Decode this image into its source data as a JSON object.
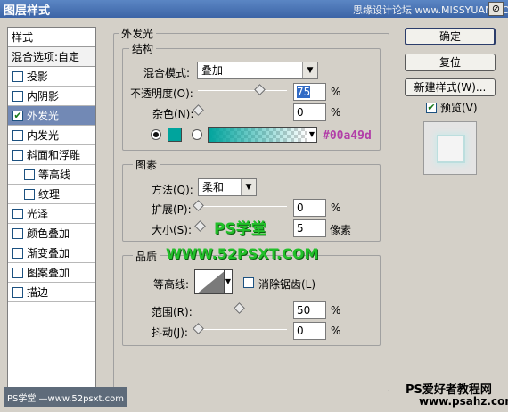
{
  "window": {
    "title": "图层样式",
    "close_label": "⊘",
    "watermark_top": "思缘设计论坛 www.MISSYUAN.COM"
  },
  "style_list": {
    "header": "样式",
    "blend_options": "混合选项:自定",
    "items": [
      {
        "label": "投影",
        "checked": false,
        "sub": false,
        "selected": false
      },
      {
        "label": "内阴影",
        "checked": false,
        "sub": false,
        "selected": false
      },
      {
        "label": "外发光",
        "checked": true,
        "sub": false,
        "selected": true
      },
      {
        "label": "内发光",
        "checked": false,
        "sub": false,
        "selected": false
      },
      {
        "label": "斜面和浮雕",
        "checked": false,
        "sub": false,
        "selected": false
      },
      {
        "label": "等高线",
        "checked": false,
        "sub": true,
        "selected": false
      },
      {
        "label": "纹理",
        "checked": false,
        "sub": true,
        "selected": false
      },
      {
        "label": "光泽",
        "checked": false,
        "sub": false,
        "selected": false
      },
      {
        "label": "颜色叠加",
        "checked": false,
        "sub": false,
        "selected": false
      },
      {
        "label": "渐变叠加",
        "checked": false,
        "sub": false,
        "selected": false
      },
      {
        "label": "图案叠加",
        "checked": false,
        "sub": false,
        "selected": false
      },
      {
        "label": "描边",
        "checked": false,
        "sub": false,
        "selected": false
      }
    ]
  },
  "buttons": {
    "ok": "确定",
    "reset": "复位",
    "new_style": "新建样式(W)...",
    "preview": "预览(V)",
    "preview_checked": true
  },
  "outer_glow": {
    "title": "外发光",
    "structure": {
      "title": "结构",
      "blend_mode_label": "混合模式:",
      "blend_mode_value": "叠加",
      "opacity_label": "不透明度(O):",
      "opacity_value": "75",
      "opacity_fraction": 0.75,
      "noise_label": "杂色(N):",
      "noise_value": "0",
      "noise_fraction": 0,
      "percent": "%",
      "glow_color": "#00a49d",
      "color_note": "#00a49d"
    },
    "elements": {
      "title": "图素",
      "method_label": "方法(Q):",
      "method_value": "柔和",
      "spread_label": "扩展(P):",
      "spread_value": "0",
      "spread_fraction": 0,
      "size_label": "大小(S):",
      "size_value": "5",
      "size_fraction": 0.02,
      "percent": "%",
      "pixels": "像素"
    },
    "quality": {
      "title": "品质",
      "contour_label": "等高线:",
      "anti_alias_label": "消除锯齿(L)",
      "range_label": "范围(R):",
      "range_value": "50",
      "range_fraction": 0.5,
      "jitter_label": "抖动(J):",
      "jitter_value": "0",
      "jitter_fraction": 0,
      "percent": "%"
    }
  },
  "watermarks": {
    "ps_school": "PS学堂",
    "site_url": "WWW.52PSXT.COM",
    "bottom_right_title": "PS爱好者教程网",
    "bottom_right_url": "www.psahz.com",
    "bottom_left": "PS学堂 —www.52psxt.com"
  }
}
